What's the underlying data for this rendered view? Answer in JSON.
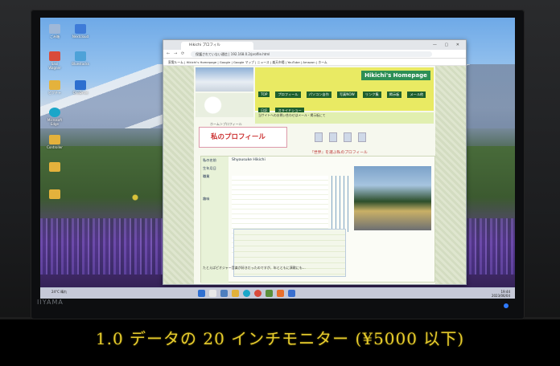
{
  "caption": "1.0 データの 20 インチモニター (¥5000 以下)",
  "monitor": {
    "brand": "IIYAMA"
  },
  "desktop": {
    "icons": [
      {
        "label": "ごみ箱"
      },
      {
        "label": "Nextcloud"
      },
      {
        "label": "Saxi Wagner"
      },
      {
        "label": "Bluestacks"
      },
      {
        "label": "ピクチャ"
      },
      {
        "label": "OneDrive"
      },
      {
        "label": "Microsoft Edge"
      },
      {
        "label": ""
      },
      {
        "label": "Controller"
      },
      {
        "label": ""
      }
    ]
  },
  "browser": {
    "tab_title": "Hikichi プロフィル",
    "url": "保護されていない通信 | 192.168.0.2/profile.html",
    "bookmarks": "家電ルーム | Hikichi's Homepage | Google | Google マップ | ニュース | 楽天市場 | YouTube | Amazon | ホーム"
  },
  "site": {
    "logo": "Hikichi's Homepage",
    "nav": [
      "TOP",
      "プロフィール",
      "パソコン自作",
      "写真NOW",
      "リンク集",
      "掲示板",
      "メール他",
      "日記",
      "スライドショー"
    ],
    "notice": "当サイトへのお問い合わせはメール・掲示板にて",
    "home_label": "ホーム＞プロフィール",
    "profile_title": "私のプロフィール",
    "intro_caption": "『世界』を選ぶ私のプロフィール",
    "name_label": "私の名前",
    "name_value": "Shyousuke Hikichi",
    "birth_label": "生年月日",
    "job_label": "職業",
    "hobby_label": "趣味",
    "bottom_text": "たとえばピオジャー音楽が好きだったのですが、年とともに演歌にも…"
  },
  "taskbar": {
    "weather": "24°C 晴れ",
    "clock_time": "19:44",
    "clock_date": "2023/06/04"
  }
}
